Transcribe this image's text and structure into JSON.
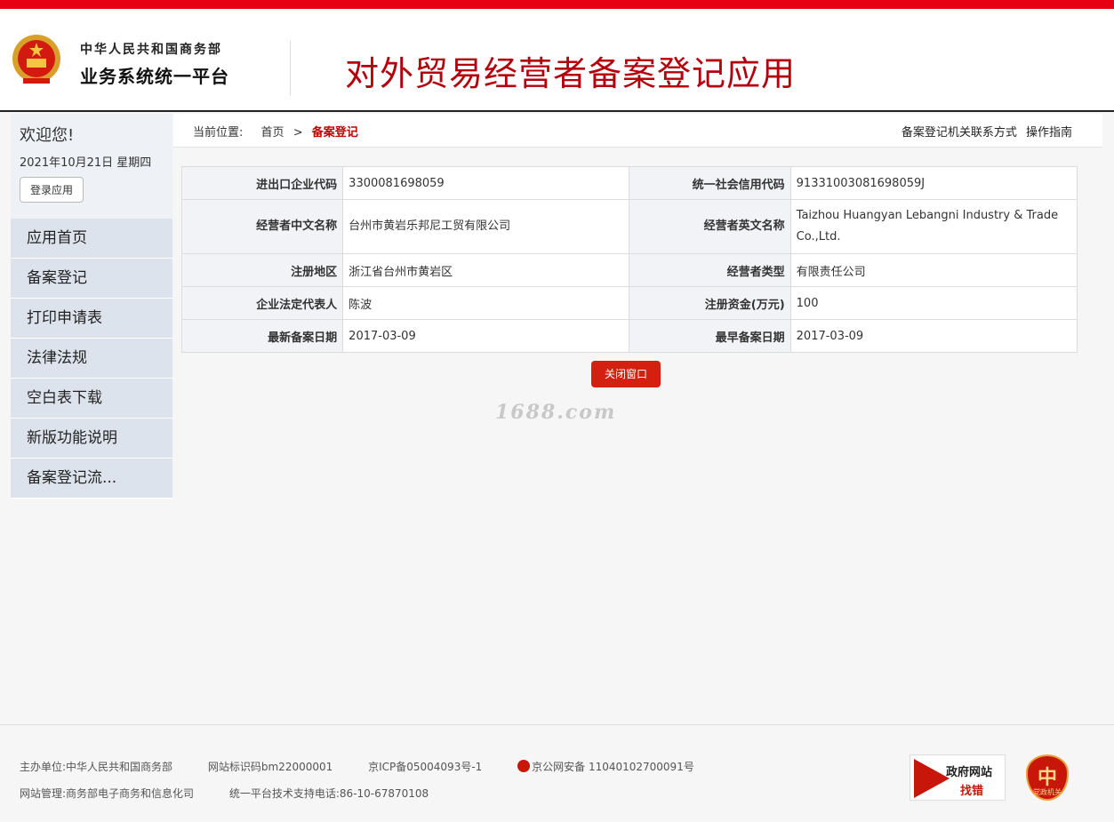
{
  "header": {
    "org_line1": "中华人民共和国商务部",
    "org_line2": "业务系统统一平台",
    "app_title": "对外贸易经营者备案登记应用"
  },
  "sidebar": {
    "welcome": "欢迎您!",
    "date": "2021年10月21日 星期四",
    "login_button": "登录应用",
    "items": [
      {
        "label": "应用首页"
      },
      {
        "label": "备案登记"
      },
      {
        "label": "打印申请表"
      },
      {
        "label": "法律法规"
      },
      {
        "label": "空白表下载"
      },
      {
        "label": "新版功能说明"
      },
      {
        "label": "备案登记流..."
      }
    ]
  },
  "breadcrumb": {
    "prefix": "当前位置:",
    "home": "首页",
    "sep": ">",
    "current": "备案登记",
    "link_contact": "备案登记机关联系方式",
    "link_guide": "操作指南"
  },
  "info": {
    "rows": [
      [
        {
          "label": "进出口企业代码",
          "value": "3300081698059"
        },
        {
          "label": "统一社会信用代码",
          "value": "91331003081698059J"
        }
      ],
      [
        {
          "label": "经营者中文名称",
          "value": "台州市黄岩乐邦尼工贸有限公司"
        },
        {
          "label": "经营者英文名称",
          "value": "Taizhou Huangyan Lebangni Industry & Trade Co.,Ltd."
        }
      ],
      [
        {
          "label": "注册地区",
          "value": "浙江省台州市黄岩区"
        },
        {
          "label": "经营者类型",
          "value": "有限责任公司"
        }
      ],
      [
        {
          "label": "企业法定代表人",
          "value": "陈波"
        },
        {
          "label": "注册资金(万元)",
          "value": "100"
        }
      ],
      [
        {
          "label": "最新备案日期",
          "value": "2017-03-09"
        },
        {
          "label": "最早备案日期",
          "value": "2017-03-09"
        }
      ]
    ]
  },
  "close_button": "关闭窗口",
  "watermark": "1688.com",
  "footer": {
    "host": "主办单位:中华人民共和国商务部",
    "site_id": "网站标识码bm22000001",
    "icp": "京ICP备05004093号-1",
    "police": "京公网安备 11040102700091号",
    "manage": "网站管理:商务部电子商务和信息化司",
    "phone": "统一平台技术支持电话:86-10-67870108",
    "gov_badge_t1": "政府网站",
    "gov_badge_t2": "找错",
    "party_badge_text": "党政机关"
  }
}
